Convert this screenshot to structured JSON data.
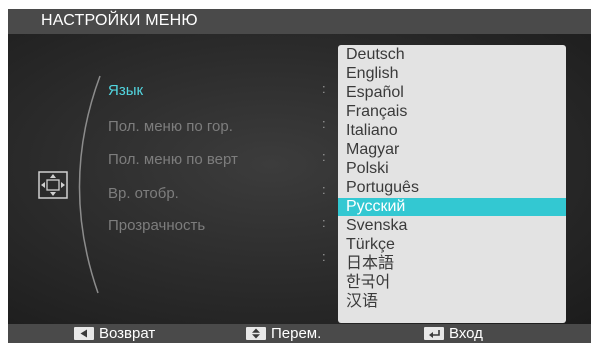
{
  "title": "НАСТРОЙКИ МЕНЮ",
  "menu_items": [
    {
      "label": "Язык",
      "active": true
    },
    {
      "label": "Пол. меню по гор."
    },
    {
      "label": "Пол. меню по верт"
    },
    {
      "label": "Вр. отобр."
    },
    {
      "label": "Прозрачность"
    },
    {
      "label": ""
    }
  ],
  "separator": ":",
  "language_options": [
    "Deutsch",
    "English",
    "Español",
    "Français",
    "Italiano",
    "Magyar",
    "Polski",
    "Português",
    "Русский",
    "Svenska",
    "Türkçe",
    "日本語",
    "한국어",
    "汉语"
  ],
  "selected_language": "Русский",
  "footer": {
    "back": "Возврат",
    "move": "Перем.",
    "enter": "Вход"
  },
  "icons": {
    "side": "monitor-adjust-icon",
    "back": "back-key-icon",
    "move": "up-down-key-icon",
    "enter": "enter-key-icon"
  },
  "colors": {
    "accent": "#33c8d2",
    "active_text": "#52d6e0",
    "bar": "#4a4a4a",
    "dropdown_bg": "#e3e3e3"
  }
}
